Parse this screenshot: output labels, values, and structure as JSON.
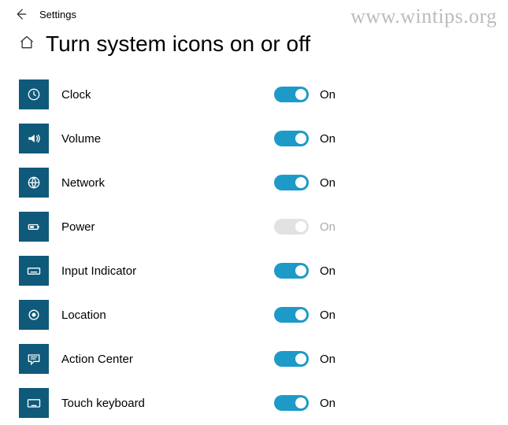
{
  "appTitle": "Settings",
  "pageHeading": "Turn system icons on or off",
  "onLabel": "On",
  "watermark": "www.wintips.org",
  "colors": {
    "accent": "#1e9ac8",
    "tile": "#0f5a7a"
  },
  "items": [
    {
      "id": "clock",
      "label": "Clock",
      "state": "On",
      "enabled": true,
      "icon": "clock-icon"
    },
    {
      "id": "volume",
      "label": "Volume",
      "state": "On",
      "enabled": true,
      "icon": "volume-icon"
    },
    {
      "id": "network",
      "label": "Network",
      "state": "On",
      "enabled": true,
      "icon": "network-icon"
    },
    {
      "id": "power",
      "label": "Power",
      "state": "On",
      "enabled": false,
      "icon": "power-icon"
    },
    {
      "id": "input-indicator",
      "label": "Input Indicator",
      "state": "On",
      "enabled": true,
      "icon": "input-indicator-icon"
    },
    {
      "id": "location",
      "label": "Location",
      "state": "On",
      "enabled": true,
      "icon": "location-icon"
    },
    {
      "id": "action-center",
      "label": "Action Center",
      "state": "On",
      "enabled": true,
      "icon": "action-center-icon"
    },
    {
      "id": "touch-keyboard",
      "label": "Touch keyboard",
      "state": "On",
      "enabled": true,
      "icon": "touch-keyboard-icon"
    }
  ]
}
